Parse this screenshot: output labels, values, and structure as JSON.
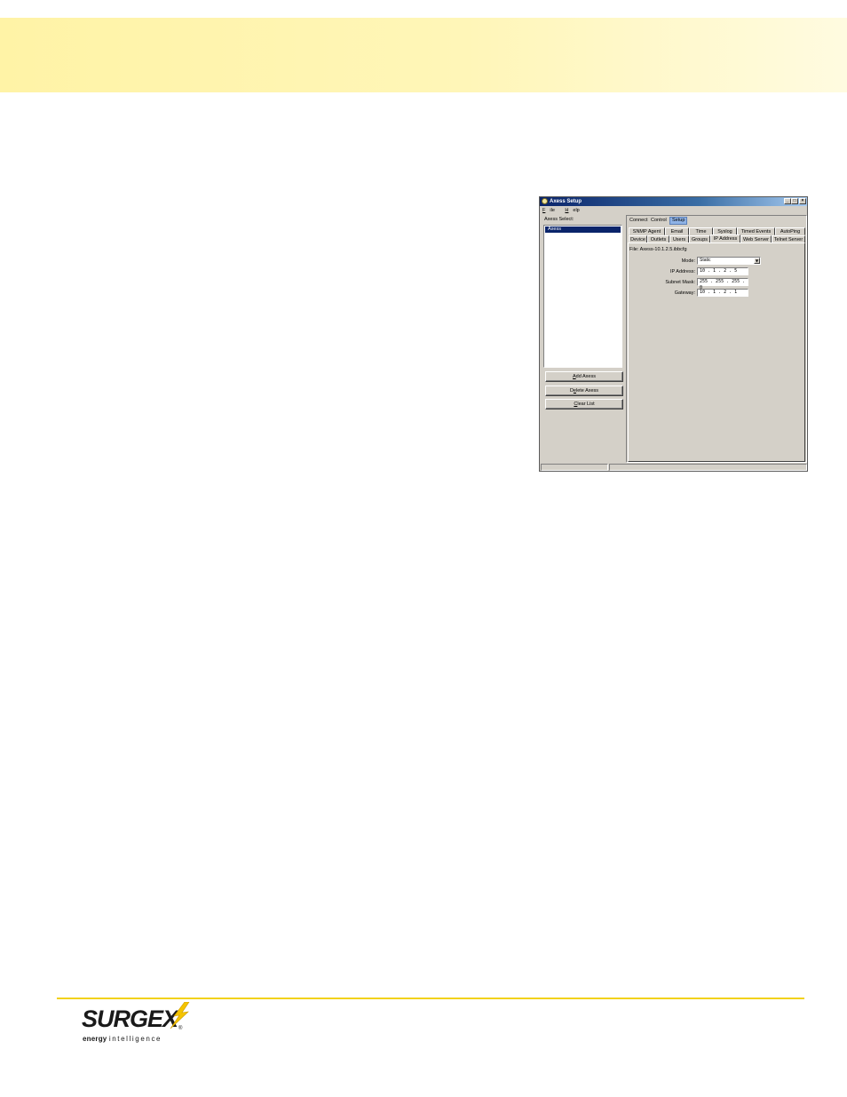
{
  "window": {
    "title": "Axess Setup",
    "controls": {
      "minimize": "_",
      "maximize": "□",
      "close": "×"
    }
  },
  "menu": [
    {
      "label": "File",
      "mnemonic": "F",
      "rest": "ile"
    },
    {
      "label": "Help",
      "mnemonic": "H",
      "rest": "elp"
    }
  ],
  "left": {
    "select_label": "Axess Select:",
    "items": [
      "Axess"
    ],
    "buttons": [
      {
        "pre": "",
        "mnemonic": "A",
        "post": "dd Axess"
      },
      {
        "pre": "D",
        "mnemonic": "e",
        "post": "lete Axess"
      },
      {
        "pre": "",
        "mnemonic": "C",
        "post": "lear List"
      }
    ]
  },
  "top_tabs": [
    "Connect",
    "Control",
    "Setup"
  ],
  "active_top_tab": "Setup",
  "sub_tabs_row1": [
    "SNMP Agent",
    "Email",
    "Time",
    "Syslog",
    "Timed Events",
    "AutoPing"
  ],
  "sub_tabs_row2": [
    "Device",
    "Outlets",
    "Users",
    "Groups",
    "IP Address",
    "Web Server",
    "Telnet Server"
  ],
  "active_sub_tab": "IP Address",
  "ip_page": {
    "file": "File: Axess-10.1.2.5.ibbcfg",
    "mode_label": "Mode:",
    "mode_value": "Static",
    "ip_label": "IP Address:",
    "ip_value": "10 .  1 .  2 .  5",
    "mask_label": "Subnet Mask:",
    "mask_value": "255 . 255 . 255 .  0",
    "gateway_label": "Gateway:",
    "gateway_value": "10 .  1 .  2 .  1"
  },
  "logo": {
    "word": "SURGEX",
    "registered": "®",
    "tagline_bold": "energy",
    "tagline_rest": "intelligence"
  },
  "colors": {
    "header_band": "#fff3a6",
    "footer_rule": "#f2d21a",
    "bolt": "#f5c400",
    "title_bar": "#0a246a",
    "selection": "#0a246a"
  }
}
